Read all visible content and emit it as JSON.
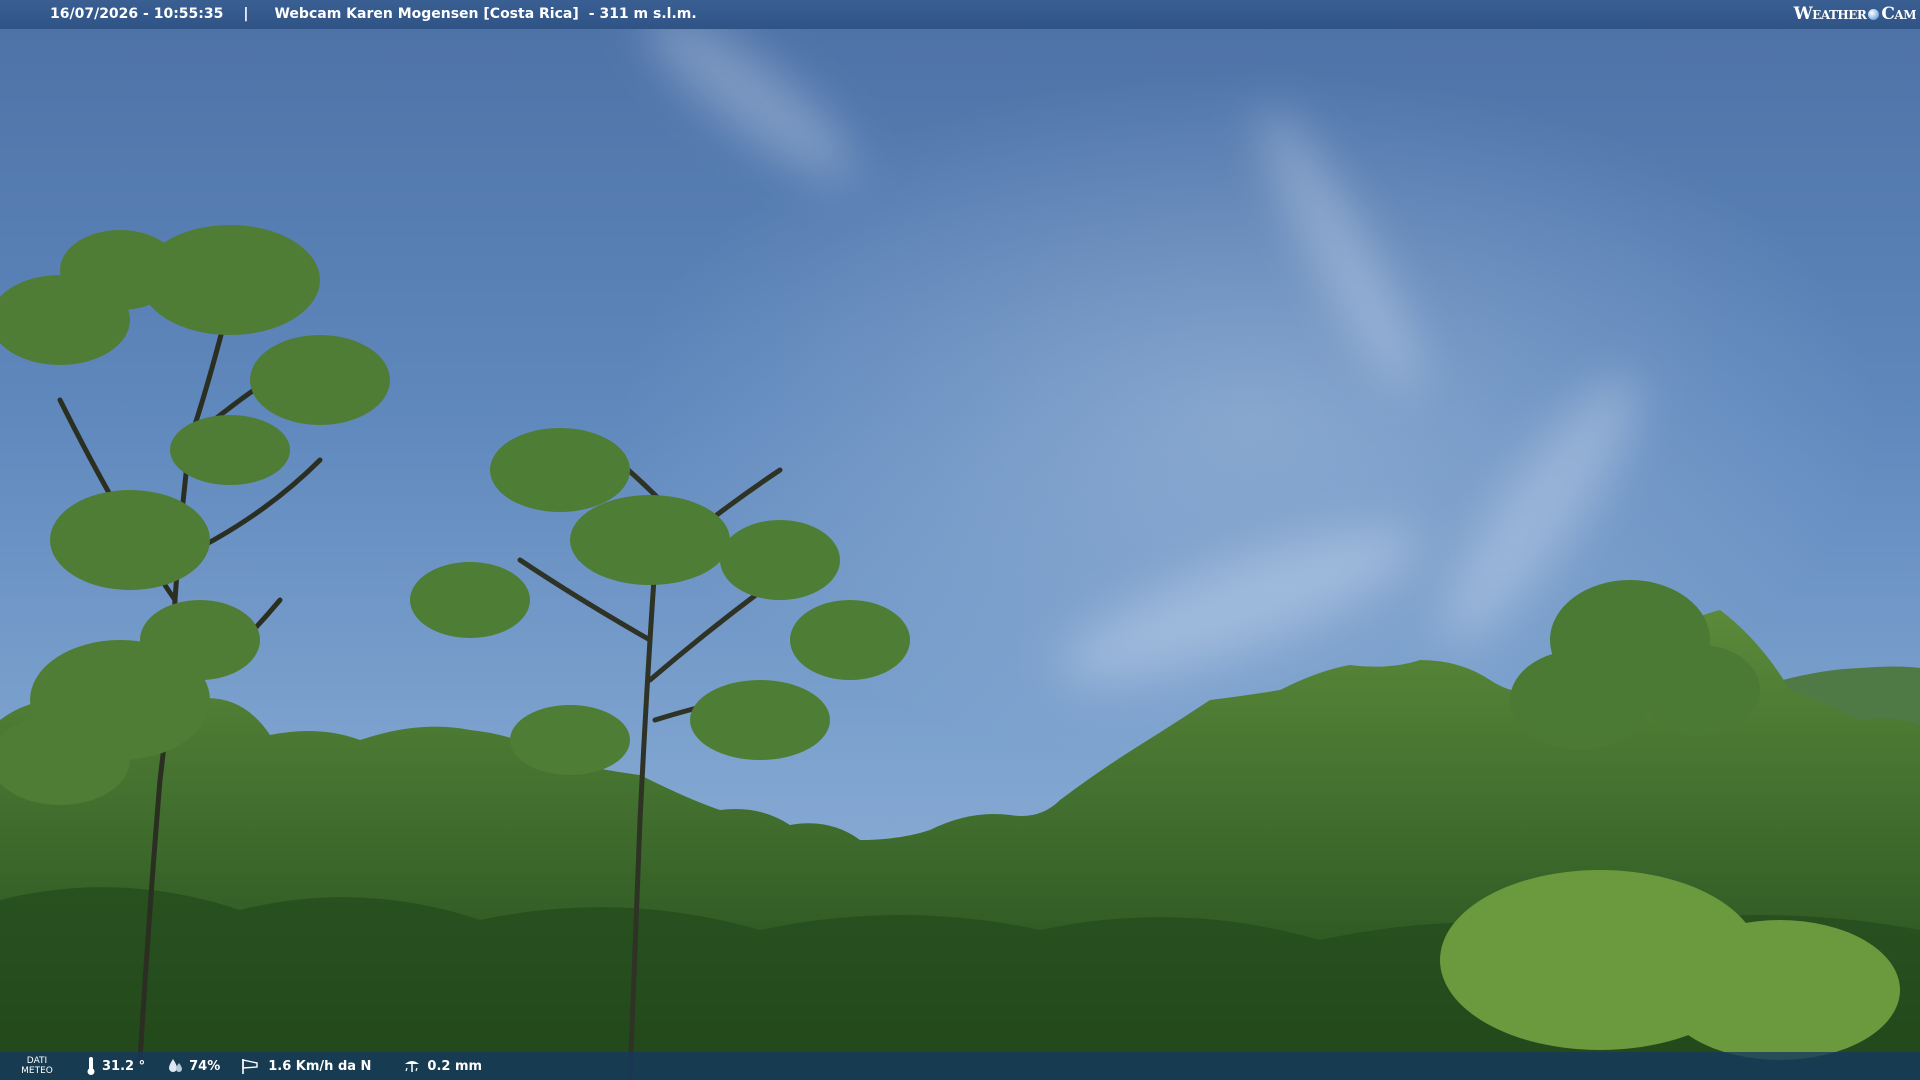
{
  "header": {
    "datetime": "16/07/2026 - 10:55:35",
    "separator": "|",
    "title": "Webcam Karen Mogensen [Costa Rica]",
    "elevation": "- 311 m s.l.m.",
    "logo_left": "Weather",
    "logo_right": "Cam"
  },
  "footer": {
    "meteo_label_line1": "DATI",
    "meteo_label_line2": "METEO",
    "temperature": "31.2 °",
    "humidity": "74%",
    "wind": "1.6 Km/h da N",
    "rain": "0.2 mm"
  },
  "colors": {
    "header_bg": "#2f5385",
    "footer_bg": "#14375f",
    "sky": "#5f88bd",
    "foliage": "#3d6a2c"
  },
  "icons": {
    "temperature": "thermometer-icon",
    "humidity": "humidity-drop-icon",
    "wind": "wind-sock-icon",
    "rain": "rain-gauge-icon"
  }
}
